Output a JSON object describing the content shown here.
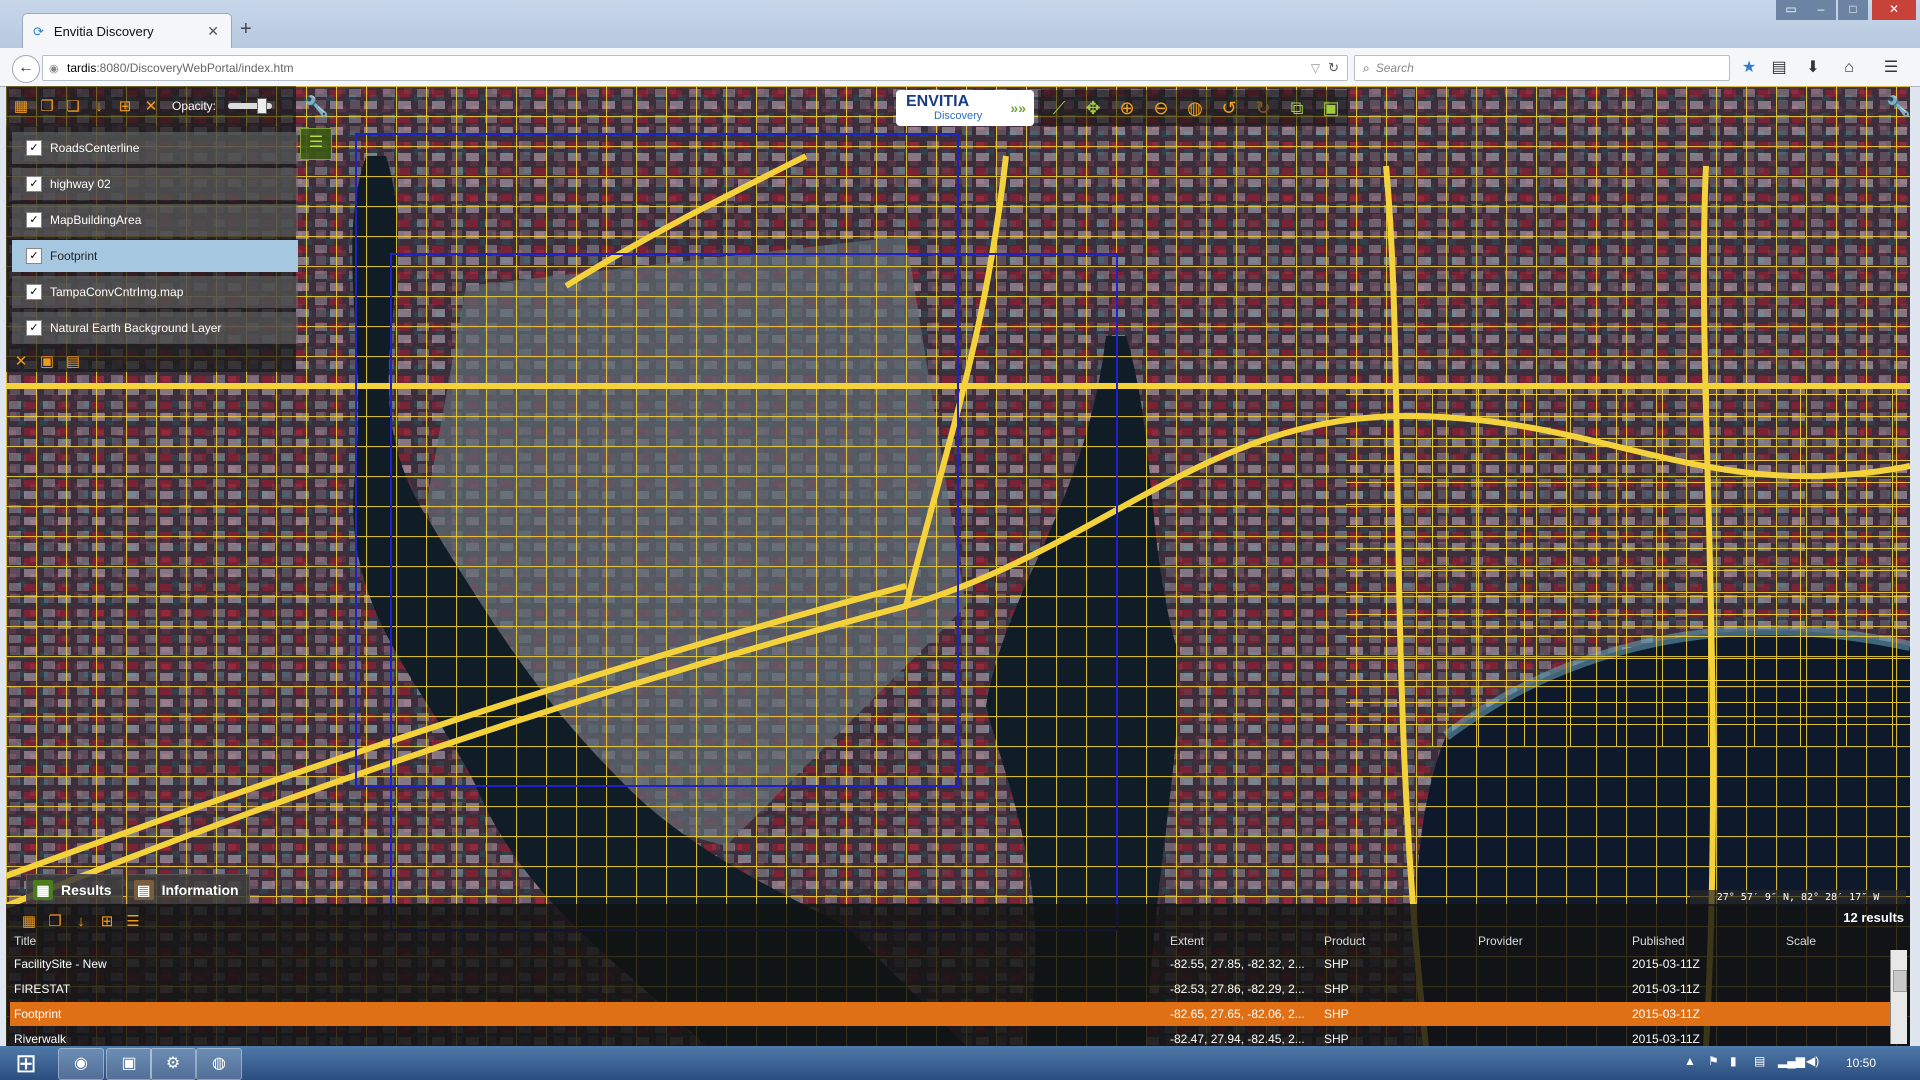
{
  "browser": {
    "tab_title": "Envitia Discovery",
    "url_host": "tardis",
    "url_path": ":8080/DiscoveryWebPortal/index.htm",
    "search_placeholder": "Search"
  },
  "map": {
    "opacity_label": "Opacity:",
    "opacity_level": 0.85,
    "layers": [
      {
        "label": "RoadsCenterline",
        "checked": true,
        "selected": false
      },
      {
        "label": "highway 02",
        "checked": true,
        "selected": false
      },
      {
        "label": "MapBuildingArea",
        "checked": true,
        "selected": false
      },
      {
        "label": "Footprint",
        "checked": true,
        "selected": true
      },
      {
        "label": "TampaConvCntrImg.map",
        "checked": true,
        "selected": false
      },
      {
        "label": "Natural Earth Background Layer",
        "checked": true,
        "selected": false
      }
    ],
    "logo_main": "ENVITIA",
    "logo_sub": "Discovery",
    "coordinates": "27° 57′  9″ N,  82° 28′ 17″ W",
    "colors": {
      "roads": "#f4d23c",
      "footprint": "#1e22c8",
      "accent": "#f29a1c",
      "water": "#101c26"
    }
  },
  "results": {
    "tabs": [
      "Results",
      "Information"
    ],
    "count_text": "12 results",
    "columns": [
      "Title",
      "Extent",
      "Product",
      "Provider",
      "Published",
      "Scale"
    ],
    "rows": [
      {
        "title": "FacilitySite - New",
        "extent": "-82.55, 27.85, -82.32, 2...",
        "product": "SHP",
        "provider": "",
        "published": "2015-03-11Z",
        "scale": "",
        "selected": false
      },
      {
        "title": "FIRESTAT",
        "extent": "-82.53, 27.86, -82.29, 2...",
        "product": "SHP",
        "provider": "",
        "published": "2015-03-11Z",
        "scale": "",
        "selected": false
      },
      {
        "title": "Footprint",
        "extent": "-82.65, 27.65, -82.06, 2...",
        "product": "SHP",
        "provider": "",
        "published": "2015-03-11Z",
        "scale": "",
        "selected": true
      },
      {
        "title": "Riverwalk",
        "extent": "-82.47, 27.94, -82.45, 2...",
        "product": "SHP",
        "provider": "",
        "published": "2015-03-11Z",
        "scale": "",
        "selected": false
      }
    ]
  },
  "taskbar": {
    "clock": "10:50"
  }
}
